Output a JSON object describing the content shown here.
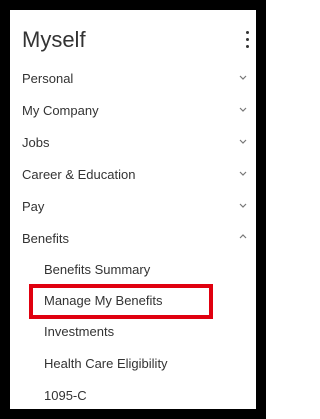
{
  "panel": {
    "title": "Myself",
    "more_icon": "kebab-vertical-icon"
  },
  "menu": [
    {
      "label": "Personal",
      "icon": "chevron-down-icon",
      "expanded": false
    },
    {
      "label": "My Company",
      "icon": "chevron-down-icon",
      "expanded": false
    },
    {
      "label": "Jobs",
      "icon": "chevron-down-icon",
      "expanded": false
    },
    {
      "label": "Career & Education",
      "icon": "chevron-down-icon",
      "expanded": false
    },
    {
      "label": "Pay",
      "icon": "chevron-down-icon",
      "expanded": false
    },
    {
      "label": "Benefits",
      "icon": "chevron-up-icon",
      "expanded": true
    }
  ],
  "benefits_submenu": [
    {
      "label": "Benefits Summary"
    },
    {
      "label": "Manage My Benefits",
      "highlighted": true
    },
    {
      "label": "Investments"
    },
    {
      "label": "Health Care Eligibility"
    },
    {
      "label": "1095-C"
    }
  ],
  "colors": {
    "text": "#333333",
    "highlight_border": "#e0000f",
    "frame_border": "#000000"
  }
}
